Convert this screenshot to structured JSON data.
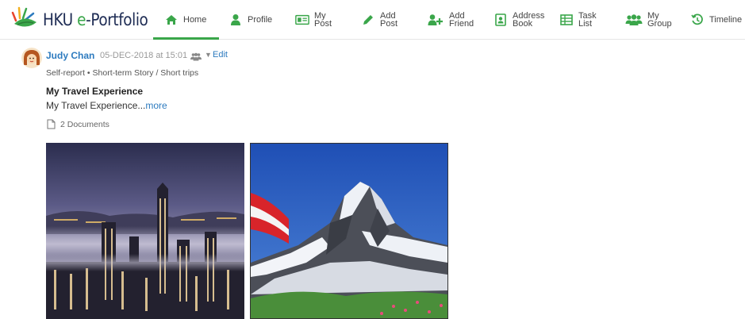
{
  "brand": {
    "logo_text_prefix": "HKU ",
    "logo_text_e": "e",
    "logo_text_suffix": "-Portfolio"
  },
  "nav": {
    "home": "Home",
    "profile": "Profile",
    "my_post": "My\nPost",
    "add_post": "Add\nPost",
    "add_friend": "Add\nFriend",
    "address_book": "Address\nBook",
    "task_list": "Task\nList",
    "my_group": "My\nGroup",
    "timeline": "Timeline"
  },
  "post": {
    "author": "Judy Chan",
    "datetime": "05-DEC-2018 at 15:01",
    "edit": "Edit",
    "category": "Self-report • Short-term Story / Short trips",
    "title": "My Travel Experience",
    "excerpt": "My Travel Experience...",
    "more": "more",
    "documents": "2 Documents"
  },
  "colors": {
    "accent_green": "#3aa64a",
    "link_blue": "#2d7bbf"
  },
  "icons": {
    "home": "home-icon",
    "profile": "user-icon",
    "my_post": "id-card-icon",
    "add_post": "pencil-icon",
    "add_friend": "add-user-icon",
    "address_book": "address-book-icon",
    "task_list": "table-icon",
    "my_group": "group-icon",
    "timeline": "history-icon"
  }
}
